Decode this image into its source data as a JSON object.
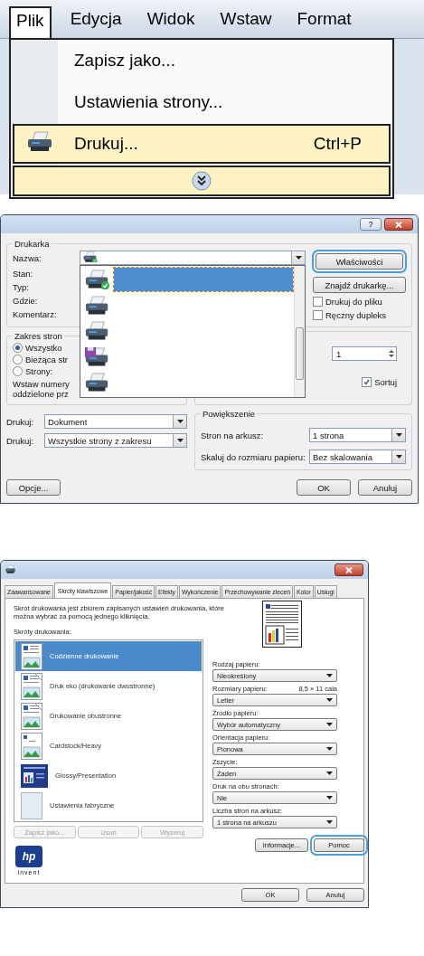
{
  "menu": {
    "items": [
      {
        "label": "Plik",
        "selected": true
      },
      {
        "label": "Edycja",
        "selected": false
      },
      {
        "label": "Widok",
        "selected": false
      },
      {
        "label": "Wstaw",
        "selected": false
      },
      {
        "label": "Format",
        "selected": false
      }
    ],
    "entries": [
      {
        "kind": "item",
        "label": "Zapisz jako...",
        "selected": false
      },
      {
        "kind": "item",
        "label": "Ustawienia strony...",
        "selected": false
      },
      {
        "kind": "item_with_icon",
        "label": "Drukuj...",
        "shortcut": "Ctrl+P",
        "selected": true
      },
      {
        "kind": "expand",
        "selected": true
      }
    ]
  },
  "print_dialog": {
    "help_label": "?",
    "printer_group": {
      "title": "Drukarka",
      "labels": [
        "Nazwa:",
        "Stan:",
        "Typ:",
        "Gdzie:",
        "Komentarz:"
      ],
      "printers": [
        {
          "kind": "default",
          "selected": true
        },
        {
          "kind": "printer",
          "selected": false
        },
        {
          "kind": "printer",
          "selected": false
        },
        {
          "kind": "file",
          "selected": false
        },
        {
          "kind": "printer",
          "selected": false
        }
      ],
      "properties_button": {
        "label": "Właściwości",
        "focused": true
      },
      "find_button": {
        "label": "Znajdź drukarkę...",
        "focused": false
      },
      "checkboxes": [
        {
          "label": "Drukuj do pliku",
          "checked": false
        },
        {
          "label": "Ręczny dupleks",
          "checked": false
        }
      ]
    },
    "range_group": {
      "title": "Zakres stron",
      "options": [
        {
          "label": "Wszystko",
          "selected": true
        },
        {
          "label": "Bieżąca str",
          "selected": false
        },
        {
          "label": "Strony:",
          "selected": false
        }
      ],
      "hint_lines": [
        "Wstaw numery",
        "oddzielone prz"
      ]
    },
    "copies": {
      "value": "1"
    },
    "collate": {
      "label": "Sortuj",
      "checked": true
    },
    "print_what": [
      {
        "label": "Drukuj:",
        "value": "Dokument"
      },
      {
        "label": "Drukuj:",
        "value": "Wszystkie strony z zakresu"
      }
    ],
    "zoom_group": {
      "title": "Powiększenie",
      "rows": [
        {
          "label": "Stron na arkusz:",
          "value": "1 strona"
        },
        {
          "label": "Skaluj do rozmiaru papieru:",
          "value": "Bez skalowania"
        }
      ]
    },
    "options_button": "Opcje...",
    "ok_button": {
      "label": "OK",
      "focused": false
    },
    "cancel_button": "Anuluj"
  },
  "properties_dialog": {
    "tabs": [
      {
        "label": "Zaawansowane",
        "selected": false
      },
      {
        "label": "Skróty klawiszowe",
        "selected": true
      },
      {
        "label": "Papier/jakość",
        "selected": false
      },
      {
        "label": "Efekty",
        "selected": false
      },
      {
        "label": "Wykończenie",
        "selected": false
      },
      {
        "label": "Przechowywanie zleceń",
        "selected": false
      },
      {
        "label": "Kolor",
        "selected": false
      },
      {
        "label": "Usługi",
        "selected": false
      }
    ],
    "description": "Skrót drukowania jest zbiorem zapisanych ustawień drukowania, które można wybrać za pomocą jednego kliknięcia.",
    "list_label": "Skróty drukowania:",
    "shortcuts": [
      {
        "kind": "document",
        "label": "Codzienne drukowanie",
        "selected": true
      },
      {
        "kind": "eco",
        "label": "Druk eko (drukowanie dwustronne)",
        "selected": false
      },
      {
        "kind": "duplex",
        "label": "Drukowanie obustronne",
        "selected": false
      },
      {
        "kind": "cardstock",
        "label": "Cardstock/Heavy",
        "selected": false
      },
      {
        "kind": "glossy",
        "label": "Glossy/Presentation",
        "selected": false
      },
      {
        "kind": "blank",
        "label": "Ustawienia fabryczne",
        "selected": false
      }
    ],
    "list_buttons": [
      {
        "label": "Zapisz jako...",
        "disabled": true
      },
      {
        "label": "Usuń",
        "disabled": true
      },
      {
        "label": "Wyzeruj",
        "disabled": true
      }
    ],
    "logo": {
      "mark": "hp",
      "tagline": "invent"
    },
    "fields": [
      {
        "label": "Rodzaj papieru:",
        "value": "Nieokreślony"
      },
      {
        "label": "Rozmiary papieru:",
        "note": "8,5 × 11 cala",
        "value": "Letter"
      },
      {
        "label": "Źródło papieru:",
        "value": "Wybór automatyczny"
      },
      {
        "label": "Orientacja papieru:",
        "value": "Pionowa"
      },
      {
        "label": "Zszycie:",
        "value": "Żaden"
      },
      {
        "label": "Druk na obu stronach:",
        "value": "Nie"
      },
      {
        "label": "Liczba stron na arkusz:",
        "value": "1 strona na arkuszu"
      }
    ],
    "info_button": {
      "label": "Informacje...",
      "focused": false
    },
    "help_button": {
      "label": "Pomoc",
      "focused": true
    },
    "ok_button": {
      "label": "OK",
      "focused": false
    },
    "cancel_button": "Anuluj"
  }
}
